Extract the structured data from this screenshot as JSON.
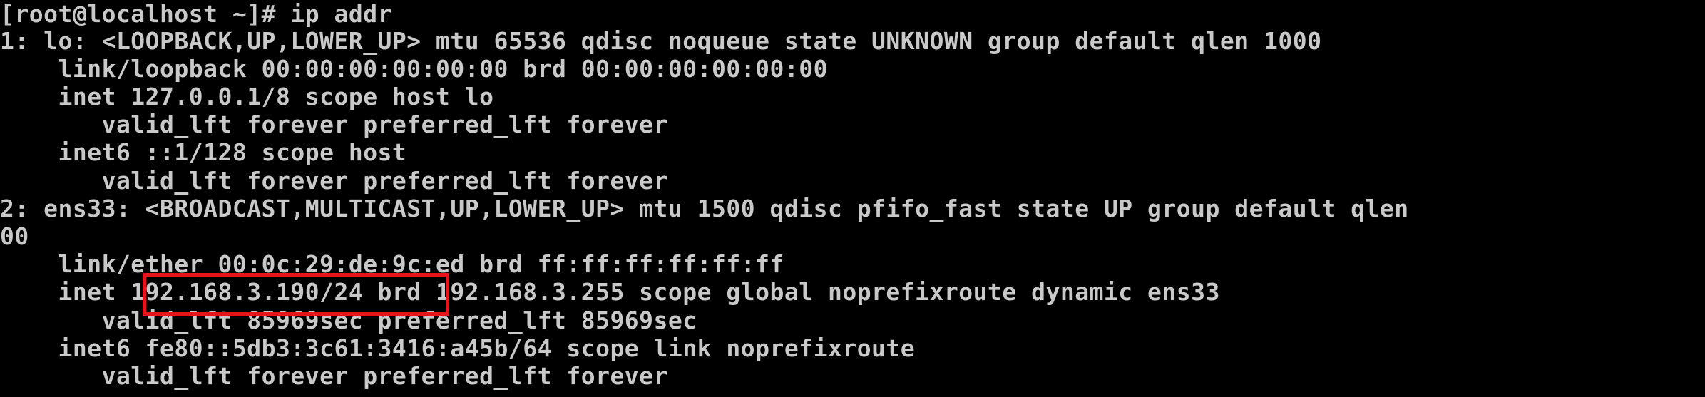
{
  "terminal": {
    "lines": [
      "[root@localhost ~]# ip addr",
      "1: lo: <LOOPBACK,UP,LOWER_UP> mtu 65536 qdisc noqueue state UNKNOWN group default qlen 1000",
      "    link/loopback 00:00:00:00:00:00 brd 00:00:00:00:00:00",
      "    inet 127.0.0.1/8 scope host lo",
      "       valid_lft forever preferred_lft forever",
      "    inet6 ::1/128 scope host",
      "       valid_lft forever preferred_lft forever",
      "2: ens33: <BROADCAST,MULTICAST,UP,LOWER_UP> mtu 1500 qdisc pfifo_fast state UP group default qlen",
      "00",
      "    link/ether 00:0c:29:de:9c:ed brd ff:ff:ff:ff:ff:ff",
      "    inet 192.168.3.190/24 brd 192.168.3.255 scope global noprefixroute dynamic ens33",
      "       valid_lft 85969sec preferred_lft 85969sec",
      "    inet6 fe80::5db3:3c61:3416:a45b/64 scope link noprefixroute",
      "       valid_lft forever preferred_lft forever"
    ],
    "colors": {
      "background": "#000000",
      "text": "#c9c9c9",
      "highlight": "#e8141b"
    }
  }
}
